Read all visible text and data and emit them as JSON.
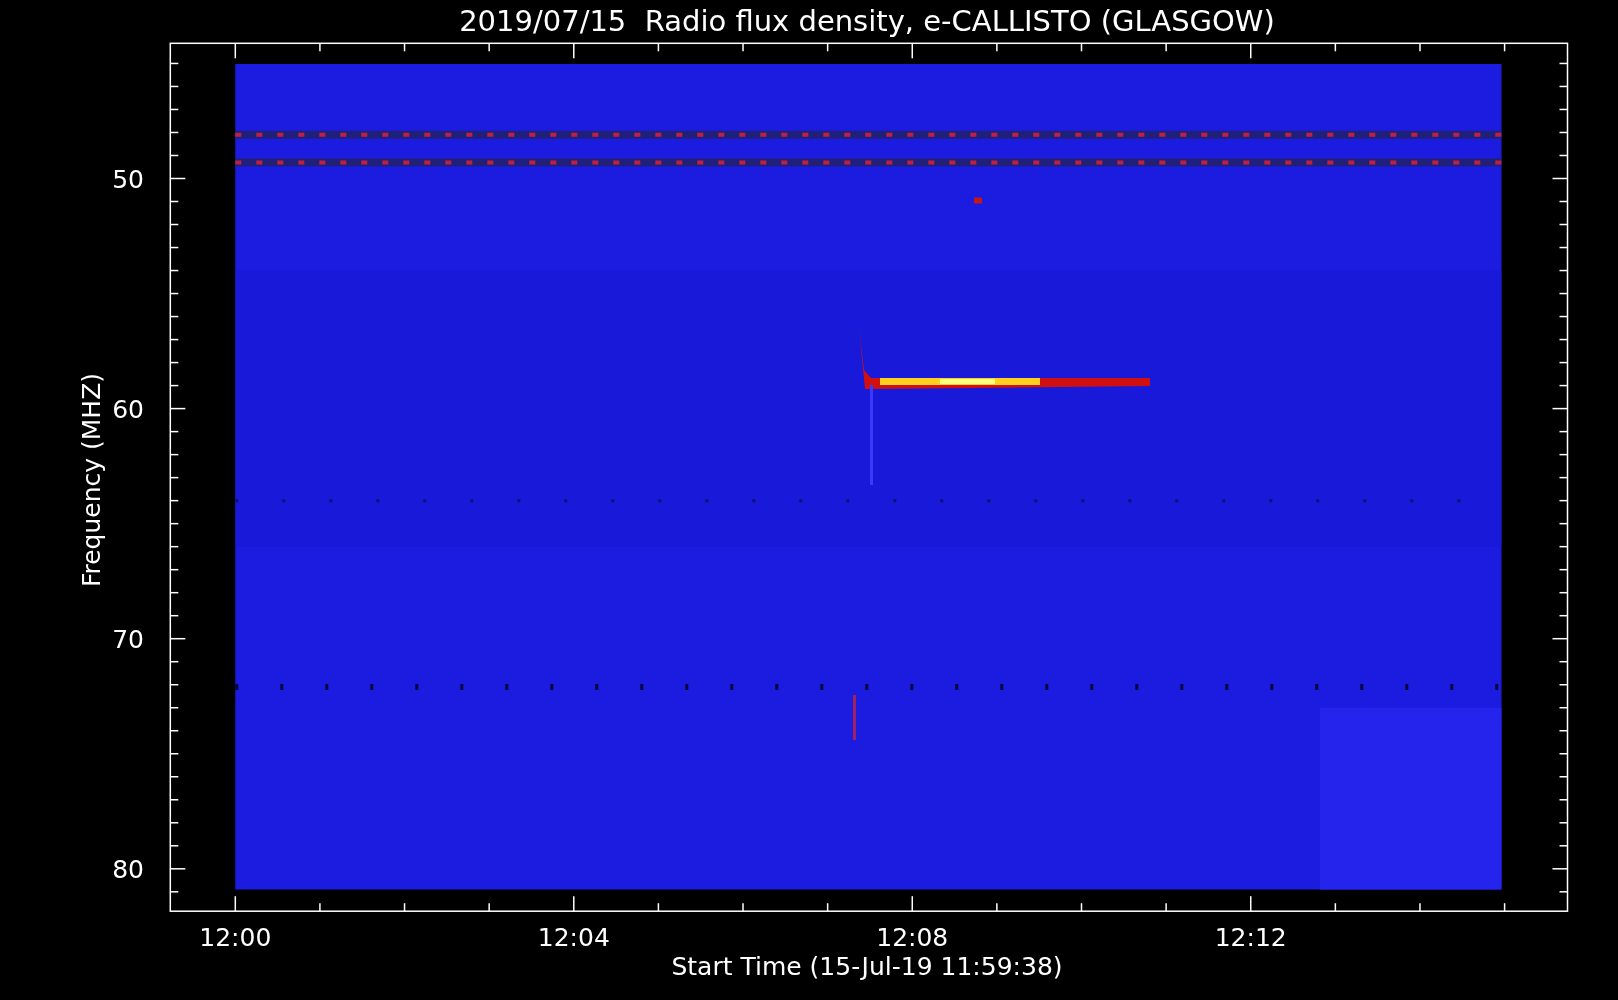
{
  "title": "2019/07/15  Radio flux density, e-CALLISTO (GLASGOW)",
  "y_axis": {
    "label": "Frequency (MHZ)",
    "ticks": [
      "50",
      "60",
      "70",
      "80"
    ]
  },
  "x_axis": {
    "label": "Start Time (15-Jul-19 11:59:38)",
    "ticks": [
      "12:00",
      "12:04",
      "12:08",
      "12:12"
    ]
  }
}
